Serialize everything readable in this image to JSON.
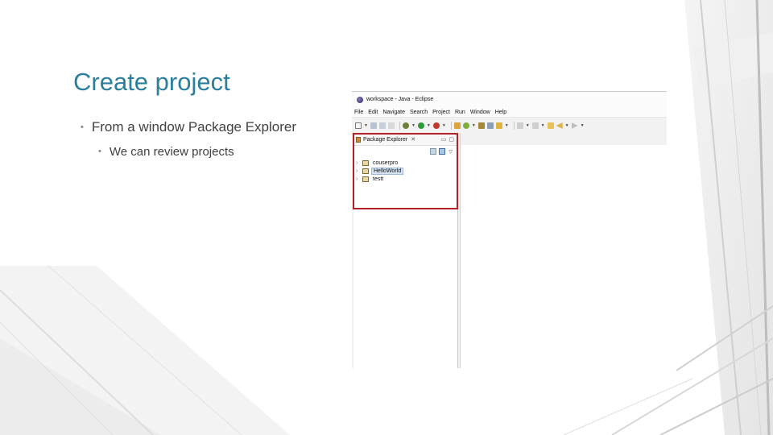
{
  "slide": {
    "title": "Create project",
    "bullets": [
      {
        "text": "From a window Package Explorer",
        "level": 1
      },
      {
        "text": "We can review projects",
        "level": 2
      }
    ],
    "bullet_glyph": "•"
  },
  "eclipse": {
    "window_title": "workspace - Java - Eclipse",
    "menu": [
      "File",
      "Edit",
      "Navigate",
      "Search",
      "Project",
      "Run",
      "Window",
      "Help"
    ],
    "package_explorer": {
      "title": "Package Explorer",
      "close_glyph": "✕",
      "minimize_glyph": "▭",
      "maximize_glyph": "▢",
      "menu_glyph": "▽",
      "projects": [
        {
          "name": "couserpro",
          "selected": false
        },
        {
          "name": "HelloWorld",
          "selected": true
        },
        {
          "name": "testt",
          "selected": false
        }
      ]
    },
    "highlight_color": "#b4202a"
  },
  "colors": {
    "title": "#2a7f9e",
    "body_text": "#404040"
  }
}
